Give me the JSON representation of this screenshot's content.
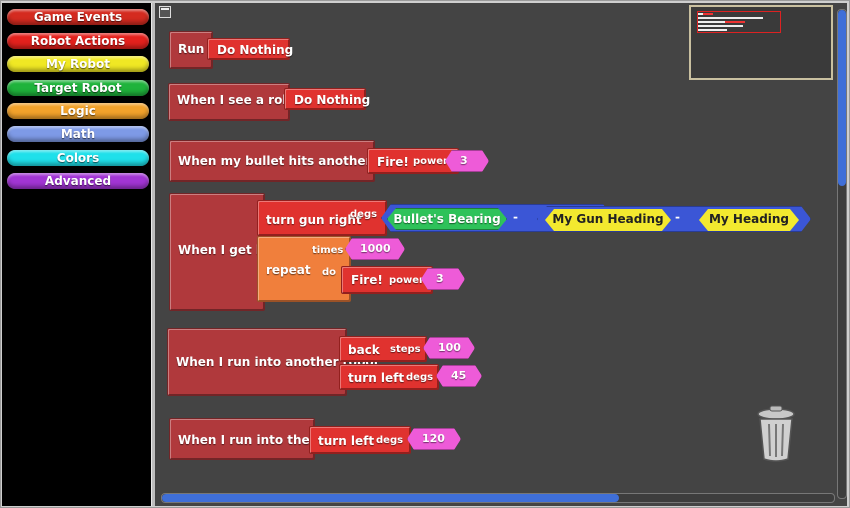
{
  "categories": [
    {
      "label": "Game Events",
      "color": "#d42b20"
    },
    {
      "label": "Robot Actions",
      "color": "#e3211d"
    },
    {
      "label": "My Robot",
      "color": "#f0e824"
    },
    {
      "label": "Target Robot",
      "color": "#1fb33c"
    },
    {
      "label": "Logic",
      "color": "#f2a22b"
    },
    {
      "label": "Math",
      "color": "#7e9ae6"
    },
    {
      "label": "Colors",
      "color": "#1fe0ea"
    },
    {
      "label": "Advanced",
      "color": "#a235d4"
    }
  ],
  "blocks": {
    "run": {
      "label": "Run",
      "action": "Do Nothing"
    },
    "see_robot": {
      "label": "When I see a robot",
      "action": "Do Nothing"
    },
    "bullet_hits": {
      "label": "When my bullet hits another robot",
      "action": "Fire!",
      "param": "power",
      "value": "3"
    },
    "get_hit": {
      "label": "When I get hit",
      "turn": "turn gun right",
      "turn_param": "degs",
      "bearing": "Bullet's Bearing",
      "minus1": "-",
      "gun_heading": "My Gun Heading",
      "minus2": "-",
      "heading": "My Heading",
      "repeat": "repeat",
      "times": "times",
      "times_value": "1000",
      "do": "do",
      "fire": "Fire!",
      "fire_param": "power",
      "fire_value": "3"
    },
    "run_into_robot": {
      "label": "When I run into another robot",
      "back": "back",
      "back_param": "steps",
      "back_value": "100",
      "turn": "turn left",
      "turn_param": "degs",
      "turn_value": "45"
    },
    "run_into_wall": {
      "label": "When I run into the wall",
      "turn": "turn left",
      "turn_param": "degs",
      "turn_value": "120"
    }
  },
  "scroll": {
    "vertical_fraction": 0.36,
    "horizontal_fraction": 0.68
  }
}
